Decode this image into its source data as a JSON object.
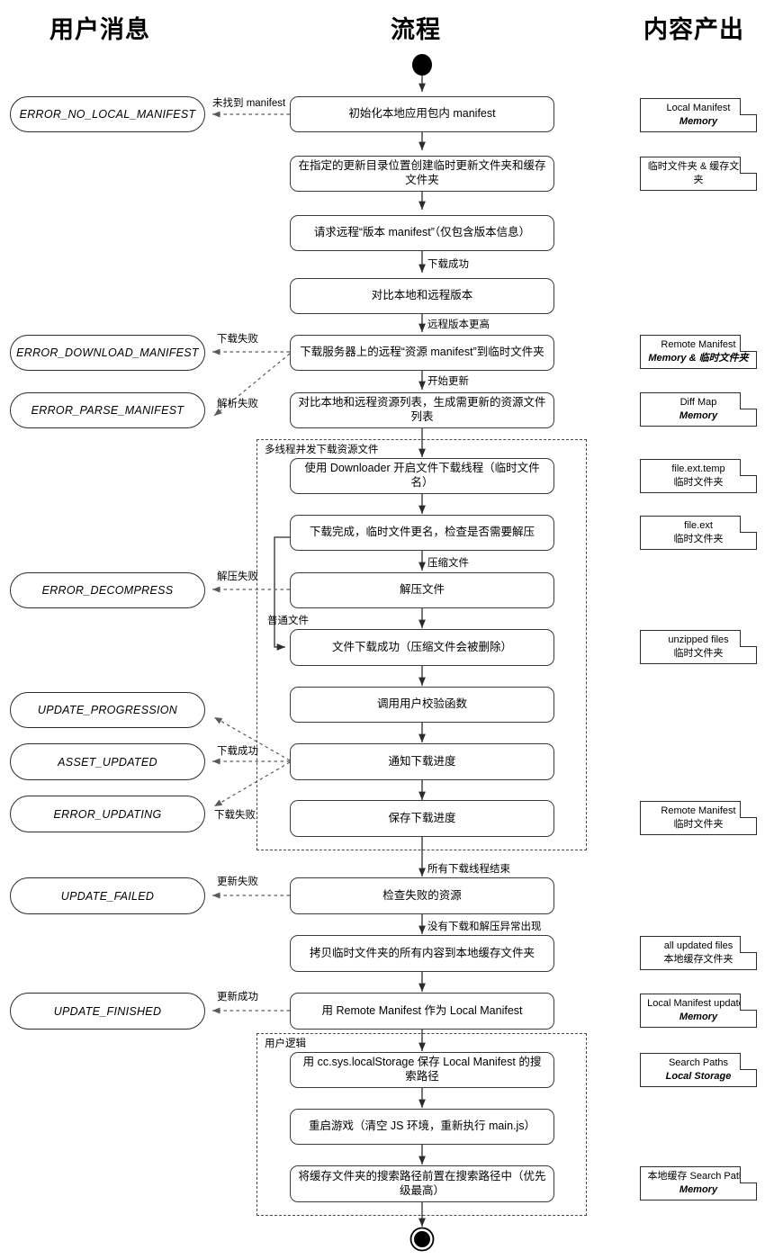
{
  "columns": {
    "left": "用户消息",
    "center": "流程",
    "right": "内容产出"
  },
  "process_steps": [
    "初始化本地应用包内 manifest",
    "在指定的更新目录位置创建临时更新文件夹和缓存文件夹",
    "请求远程“版本 manifest”（仅包含版本信息）",
    "对比本地和远程版本",
    "下载服务器上的远程“资源 manifest”到临时文件夹",
    "对比本地和远程资源列表，生成需更新的资源文件列表",
    "使用 Downloader 开启文件下载线程（临时文件名）",
    "下载完成，临时文件更名，检查是否需要解压",
    "解压文件",
    "文件下载成功（压缩文件会被删除）",
    "调用用户校验函数",
    "通知下载进度",
    "保存下载进度",
    "检查失败的资源",
    "拷贝临时文件夹的所有内容到本地缓存文件夹",
    "用 Remote Manifest 作为 Local Manifest",
    "用 cc.sys.localStorage 保存 Local Manifest 的搜索路径",
    "重启游戏（清空 JS 环境，重新执行 main.js）",
    "将缓存文件夹的搜索路径前置在搜索路径中（优先级最高）"
  ],
  "messages": [
    "ERROR_NO_LOCAL_MANIFEST",
    "ERROR_DOWNLOAD_MANIFEST",
    "ERROR_PARSE_MANIFEST",
    "ERROR_DECOMPRESS",
    "UPDATE_PROGRESSION",
    "ASSET_UPDATED",
    "ERROR_UPDATING",
    "UPDATE_FAILED",
    "UPDATE_FINISHED"
  ],
  "edge_labels": {
    "no_manifest": "未找到 manifest",
    "download_success": "下载成功",
    "remote_newer": "远程版本更高",
    "download_fail_manifest": "下载失败",
    "start_update": "开始更新",
    "parse_fail": "解析失败",
    "compressed_file": "压缩文件",
    "decompress_fail": "解压失败",
    "normal_file": "普通文件",
    "download_success2": "下载成功",
    "download_fail2": "下载失败",
    "all_threads_done": "所有下载线程结束",
    "update_fail": "更新失败",
    "no_exception": "没有下载和解压异常出现",
    "update_success": "更新成功"
  },
  "groups": [
    {
      "label": "多线程并发下载资源文件"
    },
    {
      "label": "用户逻辑"
    }
  ],
  "notes": [
    {
      "line1": "Local Manifest",
      "line2": "Memory",
      "l2_style": "en"
    },
    {
      "line1": "临时文件夹 & 缓存文件夹",
      "line2": "",
      "l2_style": "cn"
    },
    {
      "line1": "Remote Manifest",
      "line2": "Memory & 临时文件夹",
      "l2_style": "en"
    },
    {
      "line1": "Diff Map",
      "line2": "Memory",
      "l2_style": "en"
    },
    {
      "line1": "file.ext.temp",
      "line2": "临时文件夹",
      "l2_style": "cn"
    },
    {
      "line1": "file.ext",
      "line2": "临时文件夹",
      "l2_style": "cn"
    },
    {
      "line1": "unzipped files",
      "line2": "临时文件夹",
      "l2_style": "cn"
    },
    {
      "line1": "Remote Manifest",
      "line2": "临时文件夹",
      "l2_style": "cn"
    },
    {
      "line1": "all updated files",
      "line2": "本地缓存文件夹",
      "l2_style": "cn"
    },
    {
      "line1": "Local Manifest updated",
      "line2": "Memory",
      "l2_style": "en"
    },
    {
      "line1": "Search Paths",
      "line2": "Local Storage",
      "l2_style": "en"
    },
    {
      "line1": "本地缓存 Search Paths",
      "line2": "Memory",
      "l2_style": "en"
    }
  ],
  "terminators": {
    "start": "start-node",
    "end": "end-node"
  },
  "colors": {
    "stroke": "#2b2b2b",
    "dashed": "#5a5a5a",
    "background": "#ffffff",
    "text": "#000000"
  }
}
